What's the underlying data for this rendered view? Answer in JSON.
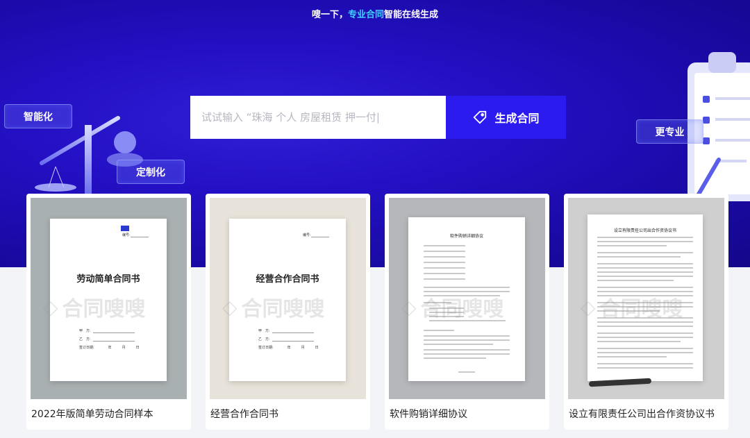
{
  "header": {
    "tagline_prefix": "嗖一下，",
    "tagline_highlight": "专业合同",
    "tagline_suffix": "智能在线生成"
  },
  "search": {
    "placeholder": "试试输入 “珠海 个人 房屋租赁 押一付|",
    "button_label": "生成合同",
    "button_icon": "tag-icon"
  },
  "features": {
    "smart": "智能化",
    "custom": "定制化",
    "professional": "更专业"
  },
  "cards": [
    {
      "title": "2022年版简单劳动合同样本",
      "doc_title": "劳动简单合同书",
      "doc_number_label": "编号:",
      "party_a": "甲　方:",
      "party_b": "乙　方:",
      "sign_date": "签订日期:　　　　年　　　月　　　日",
      "bg": "#a9b0b1"
    },
    {
      "title": "经营合作合同书",
      "doc_title": "经营合作合同书",
      "doc_number_label": "编号:",
      "party_a": "甲　方:",
      "party_b": "乙　方:",
      "sign_date": "签订日期:　　　　年　　　月　　　日",
      "bg": "#e8e3da"
    },
    {
      "title": "软件购销详细协议",
      "doc_title": "软件购销详细协议",
      "bg": "#b5b7bb"
    },
    {
      "title": "设立有限责任公司出合作资协议书",
      "doc_title": "设立有限责任公司出合作资协议书",
      "bg": "#cfcfcf"
    }
  ],
  "watermark": "合同嗖嗖"
}
